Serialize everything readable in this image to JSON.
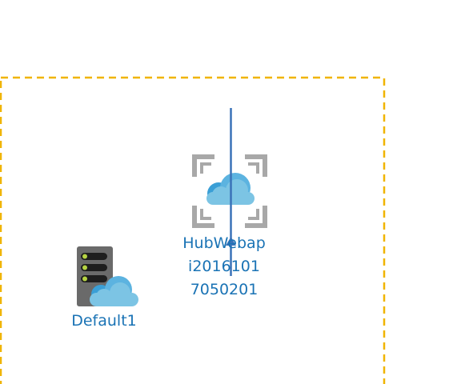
{
  "diagram": {
    "nodes": [
      {
        "id": "hub",
        "icon": "cloud-service-icon",
        "label_lines": [
          "HubWebap",
          "i2016101",
          "7050201"
        ]
      },
      {
        "id": "default1",
        "icon": "cloud-server-icon",
        "label": "Default1"
      }
    ],
    "colors": {
      "group_border": "#f0b400",
      "connector": "#3a72b8",
      "label": "#1a73b5",
      "cloud_light": "#7cc4e4",
      "cloud_dark": "#3a9fd6",
      "frame_gray": "#a8a8a8",
      "server_body": "#6a6a6a",
      "server_lights": "#b6d443"
    }
  }
}
